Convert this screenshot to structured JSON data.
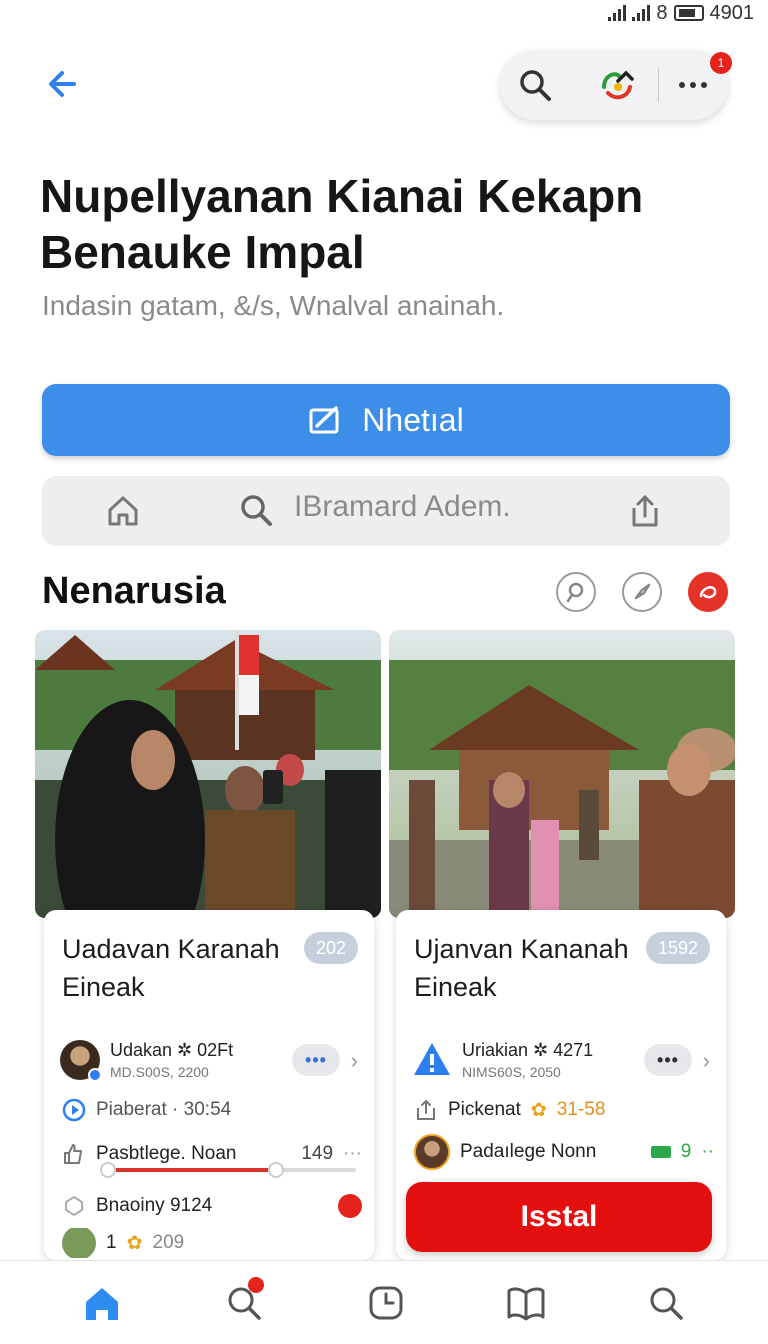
{
  "status_bar": {
    "time": "4901",
    "signal_text": "8"
  },
  "top_bar": {
    "back_icon": "arrow-left-icon",
    "search_icon": "search-icon",
    "app_icon": "colorful-logo-icon",
    "more_icon": "more-horizontal-icon",
    "notification_badge": "1"
  },
  "page": {
    "title": "Nupellyanan Kianai Kekapn Benauke Impal",
    "subtitle": "Indasin gatam, &/s, Wnalval anainah."
  },
  "primary_button": {
    "label": "Nhetıal",
    "icon": "edit-icon"
  },
  "search_row": {
    "placeholder": "IBramard Adem.",
    "home_icon": "home-icon",
    "search_icon": "search-icon",
    "share_icon": "share-icon"
  },
  "section": {
    "title": "Nenarusia",
    "icons": [
      "search-circle-icon",
      "compass-icon",
      "record-icon"
    ]
  },
  "cards": [
    {
      "title": "Uadavan Karanah Eineak",
      "count": "202",
      "author_name": "Udakan ✲ 02Ft",
      "author_meta": "MD.S00S, 2200",
      "meta_line": "Piaberat · 30:54",
      "progress_label": "Pasbtlege. Noan",
      "progress_value": "149",
      "progress_fraction": 0.68,
      "reaction_label": "Bnaoiny 9124",
      "footer_count": "209",
      "footer_prefix": "1"
    },
    {
      "title": "Ujanvan Kananah Eineak",
      "count": "1592",
      "author_name": "Uriakian ✲ 4271",
      "author_meta": "NIMS60S, 2050",
      "meta_line": "Pickenat",
      "meta_value": "31-58",
      "progress_label": "Padaılege Nonn",
      "progress_value": "9",
      "install_label": "Isstal"
    }
  ],
  "bottom_nav": [
    "home-icon",
    "search-icon",
    "clock-icon",
    "book-icon",
    "search-icon"
  ],
  "colors": {
    "accent": "#3d8ee8",
    "danger": "#e4100f",
    "muted": "#8a8a8a"
  }
}
